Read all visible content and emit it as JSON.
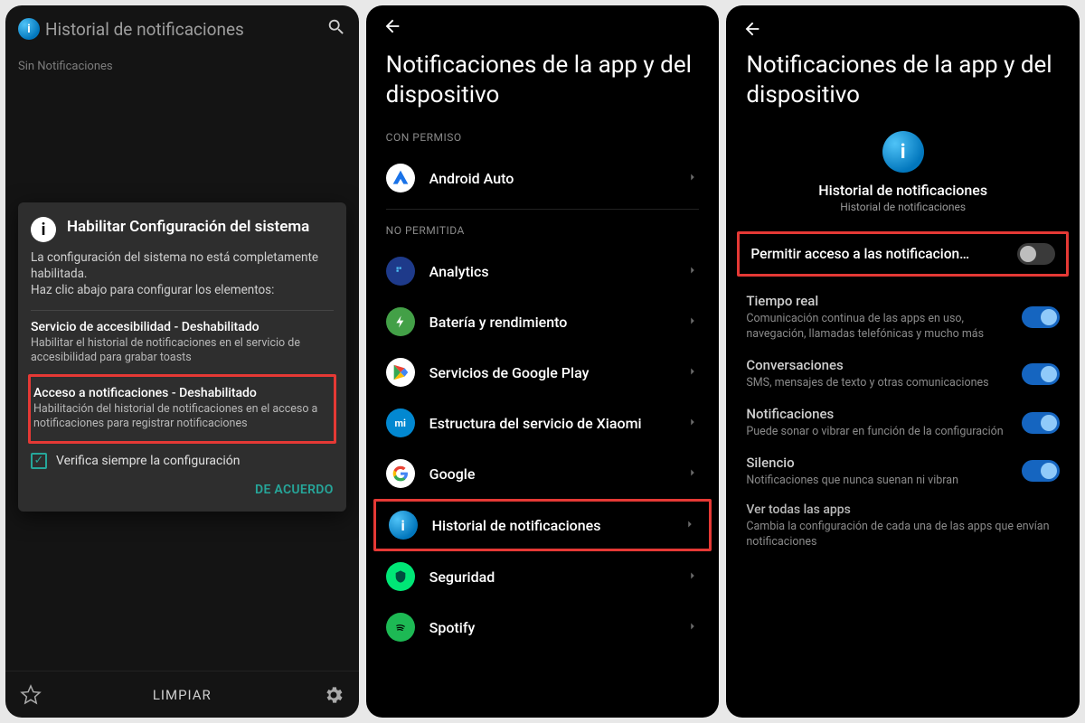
{
  "screen1": {
    "title": "Historial de notificaciones",
    "empty": "Sin Notificaciones",
    "dialog": {
      "title": "Habilitar Configuración del sistema",
      "body1": "La configuración del sistema no está completamente habilitada.",
      "body2": "Haz clic abajo para configurar los elementos:",
      "item1_t": "Servicio de accesibilidad - Deshabilitado",
      "item1_d": "Habilitar el historial de notificaciones en el servicio de accesibilidad para grabar toasts",
      "item2_t": "Acceso a notificaciones - Deshabilitado",
      "item2_d": "Habilitación del historial de notificaciones en el acceso a notificaciones para registrar notificaciones",
      "chk": "Verifica siempre la configuración",
      "ok": "DE ACUERDO"
    },
    "clear": "LIMPIAR"
  },
  "screen2": {
    "title": "Notificaciones de la app y del dispositivo",
    "sect_allowed": "CON PERMISO",
    "sect_denied": "NO PERMITIDA",
    "allowed": [
      {
        "name": "Android Auto"
      }
    ],
    "denied": [
      {
        "name": "Analytics"
      },
      {
        "name": "Batería y rendimiento"
      },
      {
        "name": "Servicios de Google Play"
      },
      {
        "name": "Estructura del servicio de Xiaomi"
      },
      {
        "name": "Google"
      },
      {
        "name": "Historial de notificaciones"
      },
      {
        "name": "Seguridad"
      },
      {
        "name": "Spotify"
      }
    ]
  },
  "screen3": {
    "title": "Notificaciones de la app y del dispositivo",
    "app_name": "Historial de notificaciones",
    "app_sub": "Historial de notificaciones",
    "perm_label": "Permitir acceso a las notificacion…",
    "rows": [
      {
        "t": "Tiempo real",
        "d": "Comunicación continua de las apps en uso, navegación, llamadas telefónicas y mucho más",
        "on": true
      },
      {
        "t": "Conversaciones",
        "d": "SMS, mensajes de texto y otras comunicaciones",
        "on": true
      },
      {
        "t": "Notificaciones",
        "d": "Puede sonar o vibrar en función de la configuración",
        "on": true
      },
      {
        "t": "Silencio",
        "d": "Notificaciones que nunca suenan ni vibran",
        "on": true
      }
    ],
    "all_apps_t": "Ver todas las apps",
    "all_apps_d": "Cambia la configuración de cada una de las apps que envían notificaciones"
  }
}
